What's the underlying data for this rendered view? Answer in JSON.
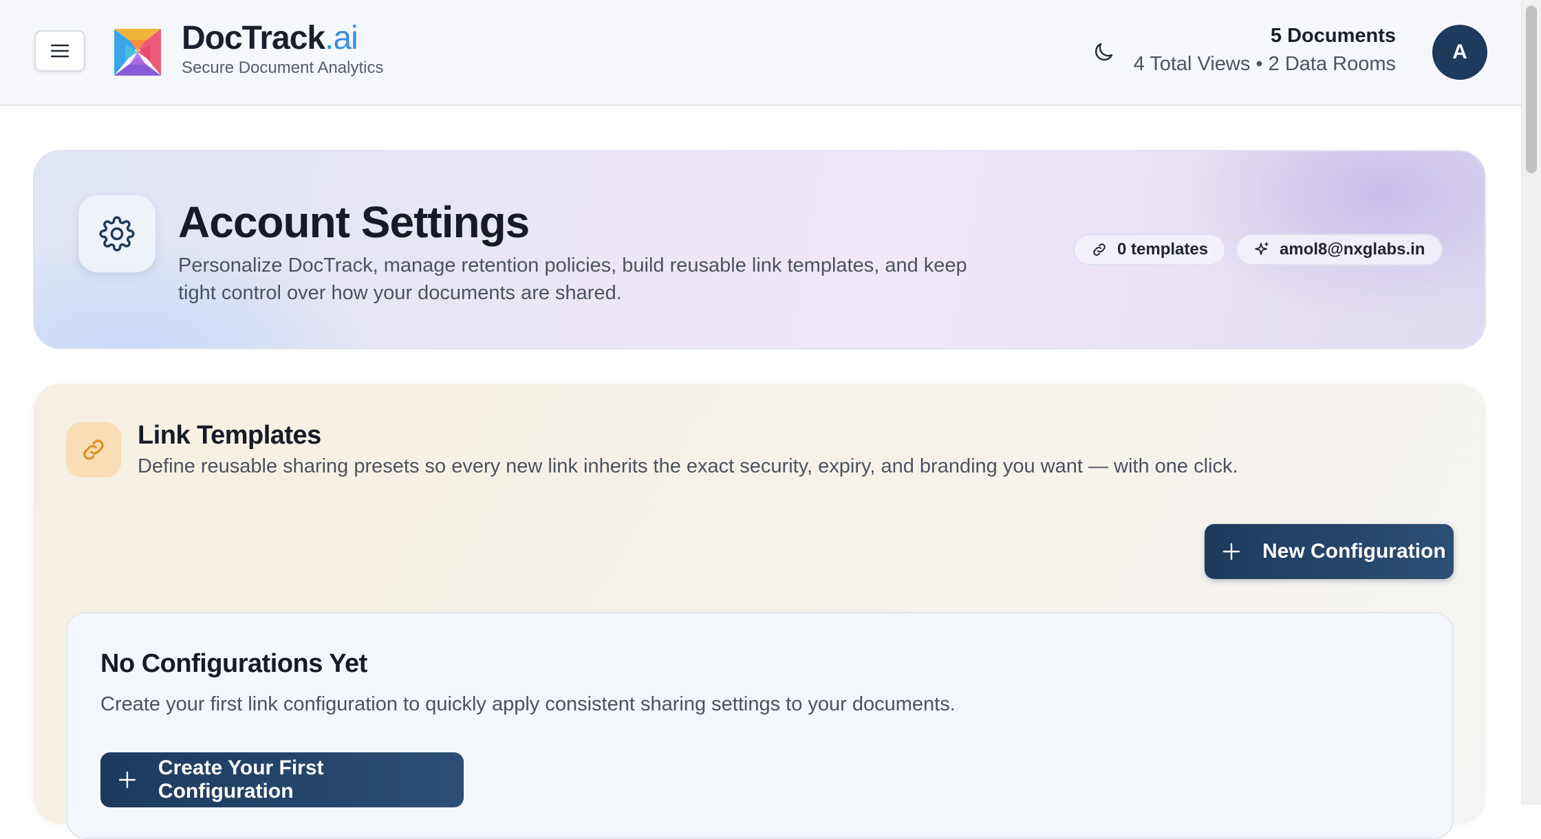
{
  "header": {
    "brand_name": "DocTrack",
    "brand_suffix": ".ai",
    "brand_subtitle": "Secure Document Analytics",
    "documents": "5 Documents",
    "views_rooms": "4 Total Views • 2 Data Rooms",
    "avatar_initial": "A"
  },
  "hero": {
    "title": "Account Settings",
    "description": "Personalize DocTrack, manage retention policies, build reusable link templates, and keep tight control over how your documents are shared.",
    "templates_pill": "0 templates",
    "email_pill": "amol8@nxglabs.in"
  },
  "link_templates": {
    "title": "Link Templates",
    "description": "Define reusable sharing presets so every new link inherits the exact security, expiry, and branding you want — with one click.",
    "new_button": "New Configuration",
    "empty": {
      "title": "No Configurations Yet",
      "description": "Create your first link configuration to quickly apply consistent sharing settings to your documents.",
      "create_button": "Create Your First Configuration"
    }
  },
  "icons": {
    "menu": "menu-icon",
    "logo": "doctrack-logo",
    "theme": "moon-icon",
    "settings": "gear-icon",
    "link": "link-icon",
    "sparkle": "sparkle-icon",
    "plus": "plus-icon"
  },
  "colors": {
    "primary": "#1e3a5c",
    "accent": "#3b8ee0",
    "link_icon": "#e0922a"
  }
}
